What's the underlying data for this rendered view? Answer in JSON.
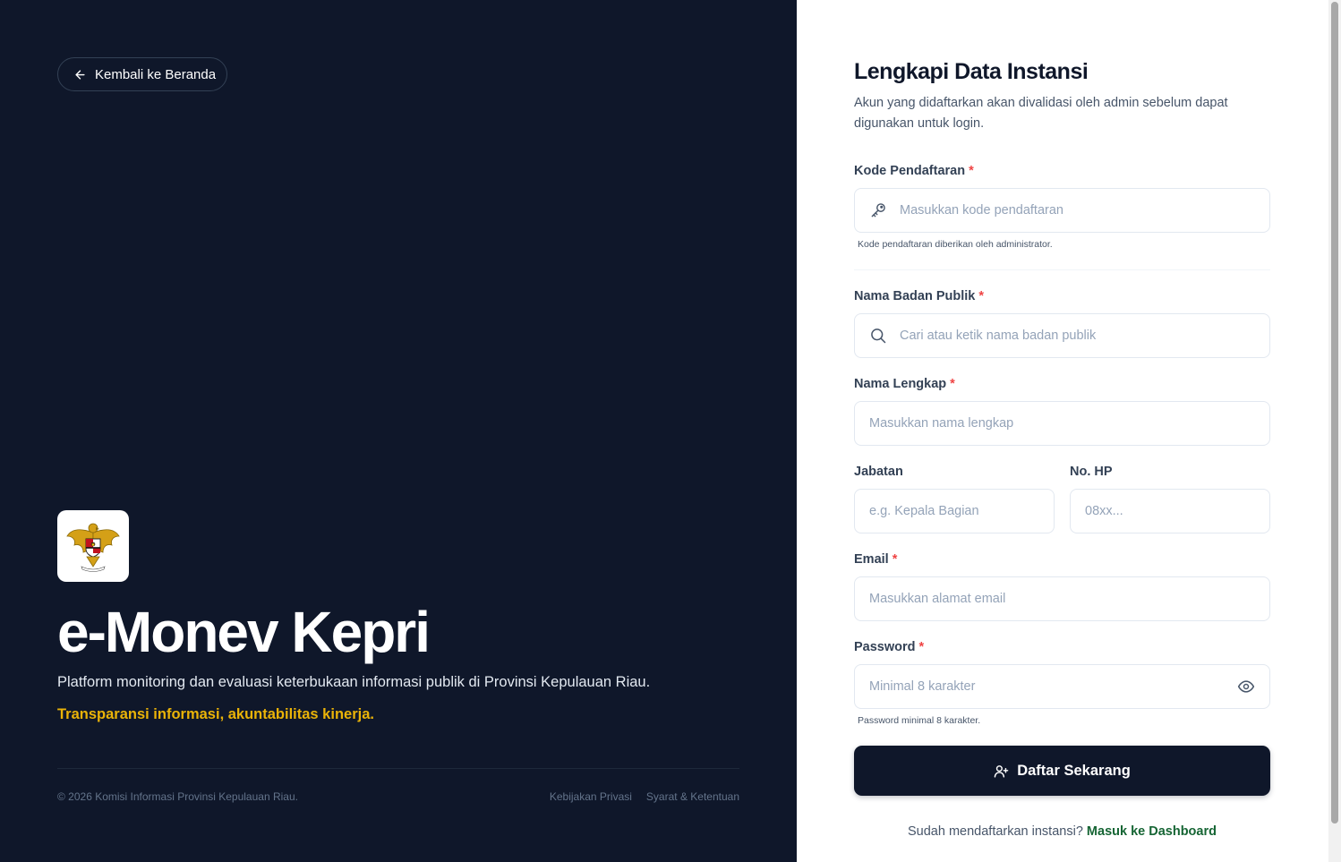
{
  "left": {
    "back_label": "Kembali ke Beranda",
    "brand_title": "e-Monev Kepri",
    "brand_description": "Platform monitoring dan evaluasi keterbukaan informasi publik di Provinsi Kepulauan Riau.",
    "brand_tagline": "Transparansi informasi, akuntabilitas kinerja.",
    "footer": {
      "copyright": "© 2026 Komisi Informasi Provinsi Kepulauan Riau.",
      "links": [
        "Kebijakan Privasi",
        "Syarat & Ketentuan"
      ]
    }
  },
  "form": {
    "title": "Lengkapi Data Instansi",
    "subtitle": "Akun yang didaftarkan akan divalidasi oleh admin sebelum dapat digunakan untuk login.",
    "required_mark": "*",
    "kode": {
      "label": "Kode Pendaftaran",
      "placeholder": "Masukkan kode pendaftaran",
      "value": "",
      "hint": "Kode pendaftaran diberikan oleh administrator."
    },
    "badan_publik": {
      "label": "Nama Badan Publik",
      "placeholder": "Cari atau ketik nama badan publik",
      "value": ""
    },
    "nama_lengkap": {
      "label": "Nama Lengkap",
      "placeholder": "Masukkan nama lengkap",
      "value": ""
    },
    "jabatan": {
      "label": "Jabatan",
      "placeholder": "e.g. Kepala Bagian",
      "value": ""
    },
    "no_hp": {
      "label": "No. HP",
      "placeholder": "08xx...",
      "value": ""
    },
    "email": {
      "label": "Email",
      "placeholder": "Masukkan alamat email",
      "value": ""
    },
    "password": {
      "label": "Password",
      "placeholder": "Minimal 8 karakter",
      "value": "",
      "hint": "Password minimal 8 karakter."
    },
    "submit_label": "Daftar Sekarang",
    "login_prompt": "Sudah mendaftarkan instansi?",
    "login_link": "Masuk ke Dashboard"
  },
  "colors": {
    "dark_bg": "#0f172a",
    "accent_yellow": "#eab308",
    "required_red": "#ef4444",
    "link_green": "#166534"
  },
  "icons": {
    "back": "arrow-left-icon",
    "logo": "garuda-emblem",
    "kode": "key-icon",
    "badan_publik": "search-icon",
    "password_toggle": "eye-icon",
    "submit": "user-plus-icon"
  }
}
